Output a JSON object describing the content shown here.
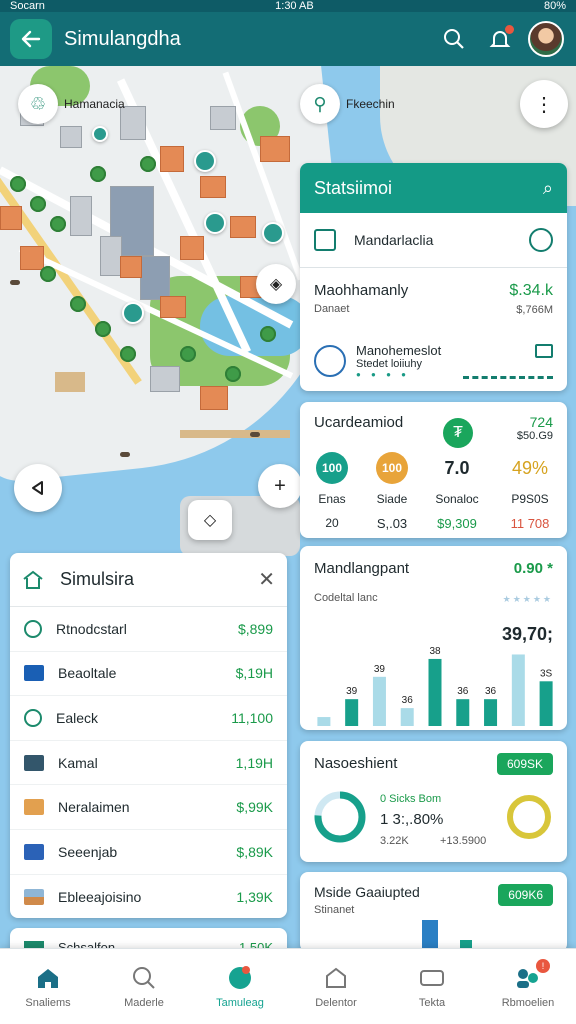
{
  "status_bar": {
    "carrier": "Socarn",
    "time": "1:30 AB",
    "battery": "80%"
  },
  "appbar": {
    "title": "Simulangdha"
  },
  "map": {
    "chip_left_label": "Hamanacia",
    "chip_right_label": "Fkeechin"
  },
  "stats_card": {
    "title": "Statsiimoi",
    "row1_label": "Mandarlaclia",
    "row2_title": "Maohhamanly",
    "row2_sub": "Danaet",
    "row2_value": "$.34.k",
    "row2_value2": "$,766M",
    "row3_title": "Manohemeslot",
    "row3_sub": "Stedet loiiuhy"
  },
  "metrics_card": {
    "title": "Ucardeamiod",
    "top_value": "724",
    "top_value2": "$50.G9",
    "cols": [
      {
        "circle": "100",
        "label": "Enas",
        "foot": "20"
      },
      {
        "circle": "100",
        "label": "Siade",
        "foot": "S,.03"
      },
      {
        "circle": "7.0",
        "label": "Sonaloc",
        "foot": "$9,309"
      },
      {
        "circle": "49%",
        "label": "P9S0S",
        "foot": "11 708"
      }
    ]
  },
  "chart_card": {
    "title": "Mandlangpant",
    "value": "0.90 *",
    "sub": "Codeltal lanc",
    "big_value": "39,70;"
  },
  "chart_data": {
    "type": "bar",
    "series": [
      {
        "values": [
          1,
          3,
          5.5,
          2,
          7.5,
          3,
          3,
          8,
          5
        ]
      }
    ],
    "labels": [
      "",
      "39",
      "39",
      "36",
      "38",
      "36",
      "36",
      "",
      "3S"
    ],
    "colors": [
      "#aadbe8",
      "#17a08b",
      "#aadbe8",
      "#aadbe8",
      "#17a08b",
      "#17a08b",
      "#17a08b",
      "#aadbe8",
      "#17a08b"
    ]
  },
  "donut_card": {
    "title": "Nasoeshient",
    "pill": "609SK",
    "line1": "0 Sicks Bom",
    "line2": "1 3:,.80%",
    "line3": "3.22K",
    "line4": "+13.5900"
  },
  "bottom_card": {
    "title": "Mside Gaaiupted",
    "sub": "Stinanet",
    "pill": "609K6"
  },
  "list_card": {
    "title": "Simulsira",
    "rows": [
      {
        "label": "Rtnodcstarl",
        "value": "$,899",
        "icon_color": "#1c8a6c"
      },
      {
        "label": "Beaoltale",
        "value": "$,19H",
        "icon_color": "#1a5fb4"
      },
      {
        "label": "Ealeck",
        "value": "11,100",
        "icon_color": "#1c8a6c"
      },
      {
        "label": "Kamal",
        "value": "1,19H",
        "icon_color": "#33566b"
      },
      {
        "label": "Neralaimen",
        "value": "$,99K",
        "icon_color": "#e2a04f"
      },
      {
        "label": "Seeenjab",
        "value": "$,89K",
        "icon_color": "#2b62b7"
      },
      {
        "label": "Ebleeajoisino",
        "value": "1,39K",
        "icon_color": "#d08a4a"
      }
    ]
  },
  "peek_card": {
    "label": "Schsalfon",
    "value": "1,50K"
  },
  "bottom_nav": [
    {
      "label": "Snaliems",
      "icon": "home-icon"
    },
    {
      "label": "Maderle",
      "icon": "search-icon"
    },
    {
      "label": "Tamuleag",
      "icon": "globe-icon"
    },
    {
      "label": "Delentor",
      "icon": "bank-icon"
    },
    {
      "label": "Tekta",
      "icon": "ticket-icon"
    },
    {
      "label": "Rbmoelien",
      "icon": "people-icon"
    }
  ]
}
